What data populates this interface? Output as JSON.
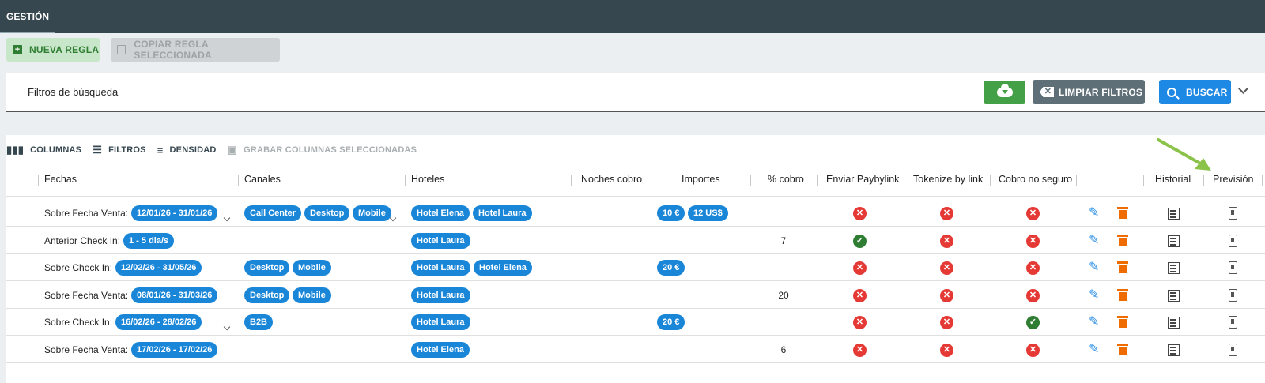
{
  "topbar": {
    "tab": "GESTIÓN"
  },
  "actions": {
    "new_rule": "NUEVA REGLA",
    "copy_rule": "COPIAR REGLA SELECCIONADA"
  },
  "filters": {
    "title": "Filtros de búsqueda",
    "clear": "LIMPIAR FILTROS",
    "search": "BUSCAR"
  },
  "toolbar": {
    "columns": "COLUMNAS",
    "filters": "FILTROS",
    "density": "DENSIDAD",
    "save_columns": "GRABAR COLUMNAS SELECCIONADAS"
  },
  "columns": [
    "Fechas",
    "Canales",
    "Hoteles",
    "Noches cobro",
    "Importes",
    "% cobro",
    "Enviar Paybylink",
    "Tokenize by link",
    "Cobro no seguro",
    "Historial",
    "Previsión"
  ],
  "rows": [
    {
      "label": "Sobre Fecha Venta:",
      "date": "12/01/26 - 31/01/26",
      "date_more": true,
      "channels": [
        "Call Center",
        "Desktop",
        "Mobile"
      ],
      "channels_more": true,
      "hotels": [
        "Hotel Elena",
        "Hotel Laura"
      ],
      "amounts": [
        "10 €",
        "12 US$"
      ],
      "percent": "",
      "paybylink": false,
      "tokenize": false,
      "unsecured": false
    },
    {
      "label": "Anterior Check In:",
      "date": "1 - 5 dia/s",
      "date_more": false,
      "channels": [],
      "channels_more": false,
      "hotels": [
        "Hotel Laura"
      ],
      "amounts": [],
      "percent": "7",
      "paybylink": true,
      "tokenize": false,
      "unsecured": false
    },
    {
      "label": "Sobre Check In:",
      "date": "12/02/26 - 31/05/26",
      "date_more": false,
      "channels": [
        "Desktop",
        "Mobile"
      ],
      "channels_more": false,
      "hotels": [
        "Hotel Laura",
        "Hotel Elena"
      ],
      "amounts": [
        "20 €"
      ],
      "percent": "",
      "paybylink": false,
      "tokenize": false,
      "unsecured": false
    },
    {
      "label": "Sobre Fecha Venta:",
      "date": "08/01/26 - 31/03/26",
      "date_more": false,
      "channels": [
        "Desktop",
        "Mobile"
      ],
      "channels_more": false,
      "hotels": [
        "Hotel Laura"
      ],
      "amounts": [],
      "percent": "20",
      "paybylink": false,
      "tokenize": false,
      "unsecured": false
    },
    {
      "label": "Sobre Check In:",
      "date": "16/02/26 - 28/02/26",
      "date_more": true,
      "channels": [
        "B2B"
      ],
      "channels_more": false,
      "hotels": [
        "Hotel Laura"
      ],
      "amounts": [
        "20 €"
      ],
      "percent": "",
      "paybylink": false,
      "tokenize": false,
      "unsecured": true
    },
    {
      "label": "Sobre Fecha Venta:",
      "date": "17/02/26 - 17/02/26",
      "date_more": false,
      "channels": [],
      "channels_more": false,
      "hotels": [
        "Hotel Elena"
      ],
      "amounts": [],
      "percent": "6",
      "paybylink": false,
      "tokenize": false,
      "unsecured": false
    }
  ],
  "colors": {
    "topbar": "#37474f",
    "chip": "#1a86d8",
    "success": "#2e7d32",
    "error": "#e53935",
    "primary": "#1e88e5",
    "delete": "#ef6c00"
  }
}
